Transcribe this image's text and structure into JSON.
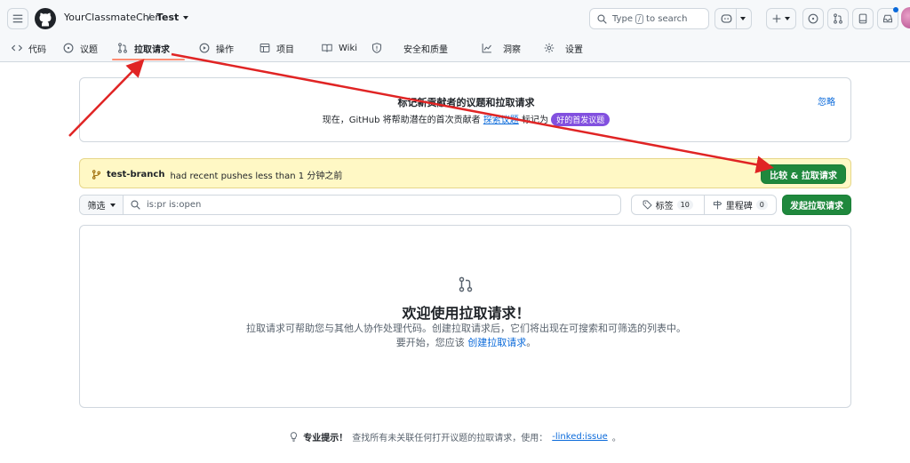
{
  "header": {
    "owner": "YourClassmateChen",
    "separator": "/",
    "repo": "Test",
    "search_placeholder_before": "Type",
    "search_key": "/",
    "search_placeholder_after": "to search"
  },
  "nav": {
    "tabs": [
      {
        "label": "代码",
        "icon": "code-icon"
      },
      {
        "label": "议题",
        "icon": "issue-opened-icon"
      },
      {
        "label": "拉取请求",
        "icon": "git-pull-request-icon",
        "active": true
      },
      {
        "label": "操作",
        "icon": "play-icon"
      },
      {
        "label": "项目",
        "icon": "table-icon"
      },
      {
        "label": "Wiki",
        "icon": "book-icon"
      },
      {
        "label": "安全和质量",
        "icon": "shield-icon"
      },
      {
        "label": "洞察",
        "icon": "graph-icon"
      },
      {
        "label": "设置",
        "icon": "gear-icon"
      }
    ]
  },
  "contributor_box": {
    "title": "标记新贡献者的议题和拉取请求",
    "line_prefix": "现在，GitHub 将帮助潜在的首次贡献者",
    "line_link": "探索议题",
    "line_mid": "标记为",
    "badge": "好的首发议题",
    "ignore": "忽略"
  },
  "push_banner": {
    "branch": "test-branch",
    "message": "had recent pushes less than 1 分钟之前",
    "compare_button": "比较 & 拉取请求"
  },
  "filters": {
    "filter_button": "筛选",
    "query": "is:pr is:open",
    "labels": "标签",
    "labels_count": "10",
    "milestones": "里程碑",
    "milestones_count": "0",
    "new_pr": "发起拉取请求"
  },
  "blankslate": {
    "title": "欢迎使用拉取请求！",
    "desc": "拉取请求可帮助您与其他人协作处理代码。创建拉取请求后，它们将出现在可搜索和可筛选的列表中。要开始，您应该",
    "desc_link": "创建拉取请求",
    "desc_end": "。"
  },
  "tip": {
    "label": "专业提示！",
    "text": "查找所有未关联任何打开议题的拉取请求，使用：",
    "query": "-linked:issue",
    "end": "。"
  },
  "colors": {
    "primary_green": "#1f883d",
    "link_blue": "#0969da",
    "annotation_red": "#e02424",
    "badge_purple": "#8250df",
    "banner_yellow": "#fff8c5"
  }
}
